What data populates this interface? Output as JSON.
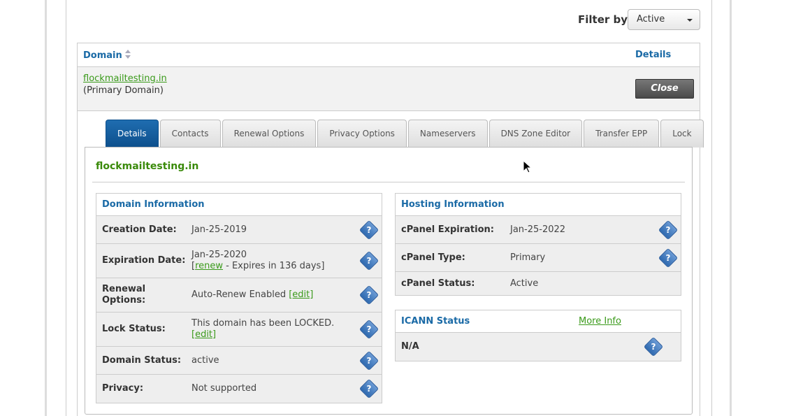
{
  "filter": {
    "label": "Filter by:",
    "selected": "Active"
  },
  "table": {
    "col_domain": "Domain",
    "col_details": "Details",
    "row": {
      "domain": "flockmailtesting.in",
      "sub": "(Primary Domain)",
      "close": "Close"
    }
  },
  "tabs": [
    "Details",
    "Contacts",
    "Renewal Options",
    "Privacy Options",
    "Nameservers",
    "DNS Zone Editor",
    "Transfer EPP",
    "Lock"
  ],
  "panel": {
    "title": "flockmailtesting.in",
    "domain_info": {
      "title": "Domain Information",
      "creation_label": "Creation Date:",
      "creation_value": "Jan-25-2019",
      "expiration_label": "Expiration Date:",
      "expiration_value": "Jan-25-2020",
      "expiration_open": "[",
      "expiration_renew": "renew",
      "expiration_rest": " - Expires in 136 days]",
      "renewal_label_1": "Renewal",
      "renewal_label_2": "Options:",
      "renewal_value": "Auto-Renew Enabled ",
      "renewal_edit": "[edit]",
      "lock_label": "Lock Status:",
      "lock_value": "This domain has been LOCKED.",
      "lock_edit": "[edit]",
      "status_label": "Domain Status:",
      "status_value": "active",
      "privacy_label": "Privacy:",
      "privacy_value": "Not supported"
    },
    "hosting_info": {
      "title": "Hosting Information",
      "exp_label": "cPanel Expiration:",
      "exp_value": "Jan-25-2022",
      "type_label": "cPanel Type:",
      "type_value": "Primary",
      "status_label": "cPanel Status:",
      "status_value": "Active"
    },
    "icann": {
      "title": "ICANN Status",
      "more_info": "More Info",
      "value": "N/A"
    },
    "help_glyph": "?"
  },
  "colors": {
    "link_green": "#3a9a1a",
    "header_blue": "#1a6aa6",
    "tab_active": "#0d4f8c"
  }
}
